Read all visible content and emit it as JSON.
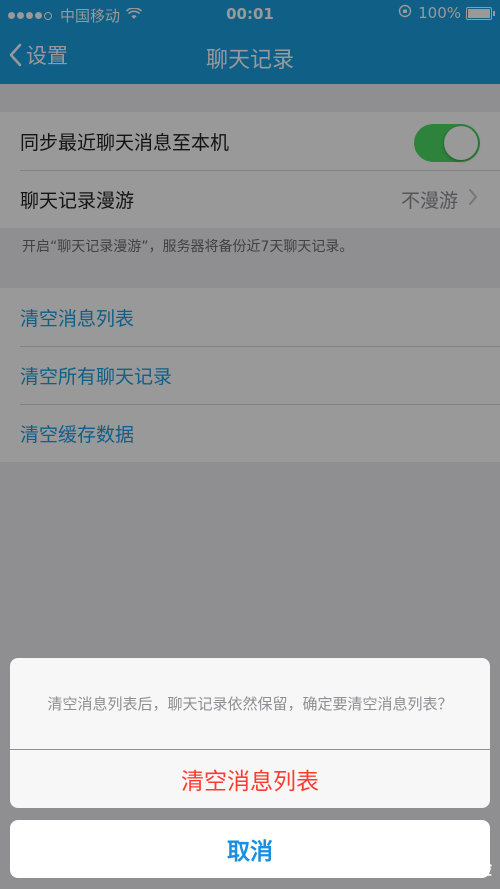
{
  "status_bar": {
    "carrier": "中国移动",
    "time": "00:01",
    "battery": "100%"
  },
  "nav": {
    "back_label": "设置",
    "title": "聊天记录"
  },
  "settings": {
    "sync_label": "同步最近聊天消息至本机",
    "sync_enabled": true,
    "roaming_label": "聊天记录漫游",
    "roaming_value": "不漫游",
    "roaming_note": "开启“聊天记录漫游”，服务器将备份近7天聊天记录。"
  },
  "actions": {
    "clear_list": "清空消息列表",
    "clear_all_chats": "清空所有聊天记录",
    "clear_cache": "清空缓存数据"
  },
  "action_sheet": {
    "message": "清空消息列表后，聊天记录依然保留，确定要清空消息列表？",
    "confirm": "清空消息列表",
    "cancel": "取消"
  },
  "colors": {
    "accent": "#1a9ee2",
    "destructive": "#ff3b30",
    "toggle_on": "#4cd964"
  },
  "watermark": "Bai 经验"
}
